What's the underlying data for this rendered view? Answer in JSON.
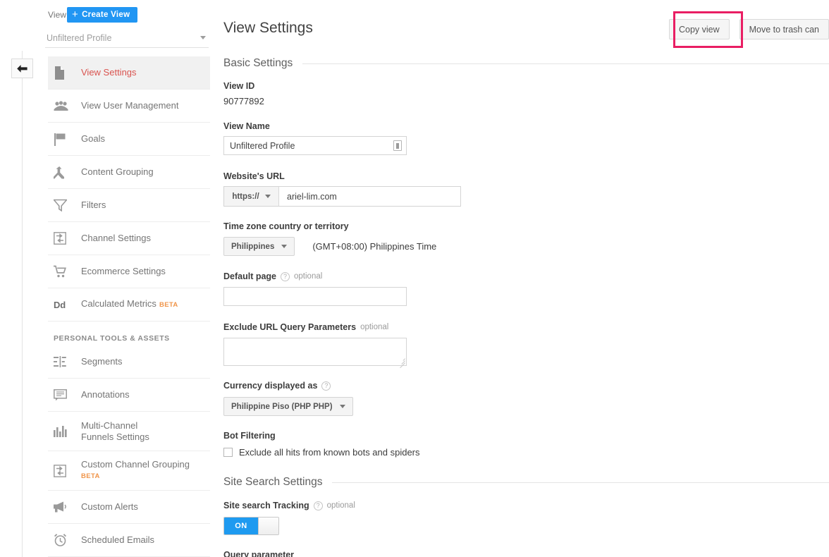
{
  "rail": {
    "back_icon": "back-arrow-icon"
  },
  "sidebar": {
    "view_label": "View",
    "create_view_button": "Create View",
    "profile_selected": "Unfiltered Profile",
    "section_header": "PERSONAL TOOLS & ASSETS",
    "items": [
      {
        "label": "View Settings",
        "icon": "document-icon",
        "active": true
      },
      {
        "label": "View User Management",
        "icon": "users-icon",
        "active": false
      },
      {
        "label": "Goals",
        "icon": "flag-icon",
        "active": false
      },
      {
        "label": "Content Grouping",
        "icon": "merge-arrows-icon",
        "active": false
      },
      {
        "label": "Filters",
        "icon": "funnel-icon",
        "active": false
      },
      {
        "label": "Channel Settings",
        "icon": "channel-arrows-icon",
        "active": false
      },
      {
        "label": "Ecommerce Settings",
        "icon": "shopping-cart-icon",
        "active": false
      },
      {
        "label": "Calculated Metrics",
        "icon": "dd-text-icon",
        "badge": "BETA",
        "active": false
      }
    ],
    "personal_items": [
      {
        "label": "Segments",
        "icon": "segments-icon",
        "active": false
      },
      {
        "label": "Annotations",
        "icon": "annotation-bubble-icon",
        "active": false
      },
      {
        "label": "Multi-Channel Funnels Settings",
        "icon": "bar-chart-icon",
        "active": false
      },
      {
        "label": "Custom Channel Grouping",
        "icon": "channel-arrows-icon",
        "badge": "BETA",
        "active": false
      },
      {
        "label": "Custom Alerts",
        "icon": "megaphone-icon",
        "active": false
      },
      {
        "label": "Scheduled Emails",
        "icon": "alarm-clock-icon",
        "active": false
      }
    ]
  },
  "main": {
    "page_title": "View Settings",
    "actions": {
      "copy_view": "Copy view",
      "move_to_trash": "Move to trash can",
      "highlight_color": "#e91e63"
    },
    "basic_settings": {
      "heading": "Basic Settings",
      "view_id_label": "View ID",
      "view_id_value": "90777892",
      "view_name_label": "View Name",
      "view_name_value": "Unfiltered Profile",
      "view_name_icon": "text-field-icon",
      "website_url_label": "Website's URL",
      "website_url_protocol": "https://",
      "website_url_value": "ariel-lim.com",
      "timezone_label": "Time zone country or territory",
      "timezone_country": "Philippines",
      "timezone_note": "(GMT+08:00) Philippines Time",
      "default_page_label": "Default page",
      "default_page_optional": "optional",
      "default_page_value": "",
      "exclude_query_label": "Exclude URL Query Parameters",
      "exclude_query_optional": "optional",
      "exclude_query_value": "",
      "currency_label": "Currency displayed as",
      "currency_value": "Philippine Piso (PHP PHP)",
      "bot_filtering_label": "Bot Filtering",
      "bot_filtering_checkbox_label": "Exclude all hits from known bots and spiders",
      "bot_filtering_checked": false
    },
    "site_search": {
      "heading": "Site Search Settings",
      "tracking_label": "Site search Tracking",
      "tracking_optional": "optional",
      "toggle_state": "ON",
      "query_parameter_label": "Query parameter"
    }
  }
}
